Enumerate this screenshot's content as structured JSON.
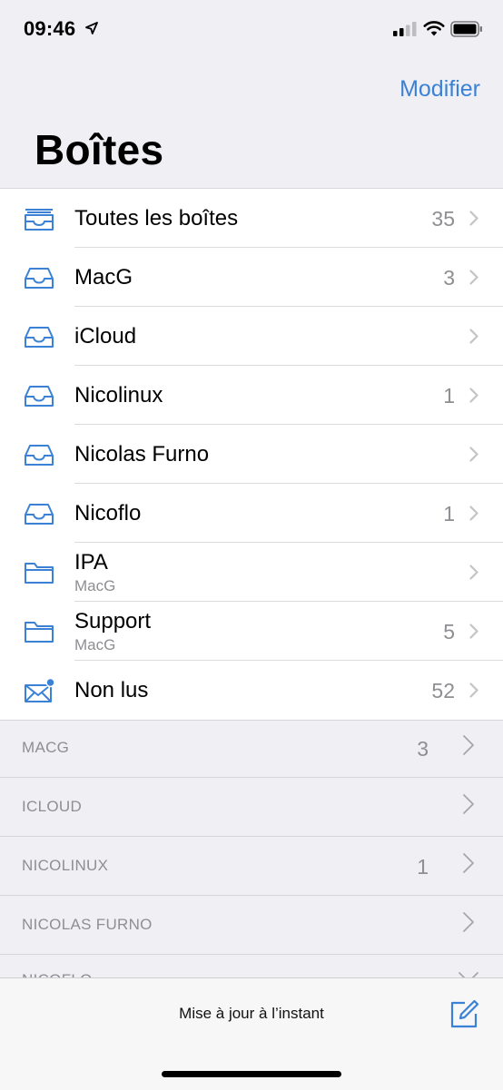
{
  "status_bar": {
    "time": "09:46"
  },
  "nav": {
    "edit_label": "Modifier",
    "title": "Boîtes"
  },
  "mailboxes": [
    {
      "name": "Toutes les boîtes",
      "count": "35",
      "icon": "all-inboxes-icon",
      "subtitle": ""
    },
    {
      "name": "MacG",
      "count": "3",
      "icon": "inbox-icon",
      "subtitle": ""
    },
    {
      "name": "iCloud",
      "count": "",
      "icon": "inbox-icon",
      "subtitle": ""
    },
    {
      "name": "Nicolinux",
      "count": "1",
      "icon": "inbox-icon",
      "subtitle": ""
    },
    {
      "name": "Nicolas Furno",
      "count": "",
      "icon": "inbox-icon",
      "subtitle": ""
    },
    {
      "name": "Nicoflo",
      "count": "1",
      "icon": "inbox-icon",
      "subtitle": ""
    },
    {
      "name": "IPA",
      "count": "",
      "icon": "folder-icon",
      "subtitle": "MacG"
    },
    {
      "name": "Support",
      "count": "5",
      "icon": "folder-icon",
      "subtitle": "MacG"
    },
    {
      "name": "Non lus",
      "count": "52",
      "icon": "unread-envelope-icon",
      "subtitle": ""
    }
  ],
  "accounts": [
    {
      "label": "MACG",
      "count": "3"
    },
    {
      "label": "ICLOUD",
      "count": ""
    },
    {
      "label": "NICOLINUX",
      "count": "1"
    },
    {
      "label": "NICOLAS FURNO",
      "count": ""
    },
    {
      "label": "NICOFLO",
      "count": ""
    }
  ],
  "toolbar": {
    "status": "Mise à jour à l’instant"
  },
  "colors": {
    "accent": "#3b82d6",
    "background": "#efeff4",
    "secondary_text": "#8e8e93"
  }
}
